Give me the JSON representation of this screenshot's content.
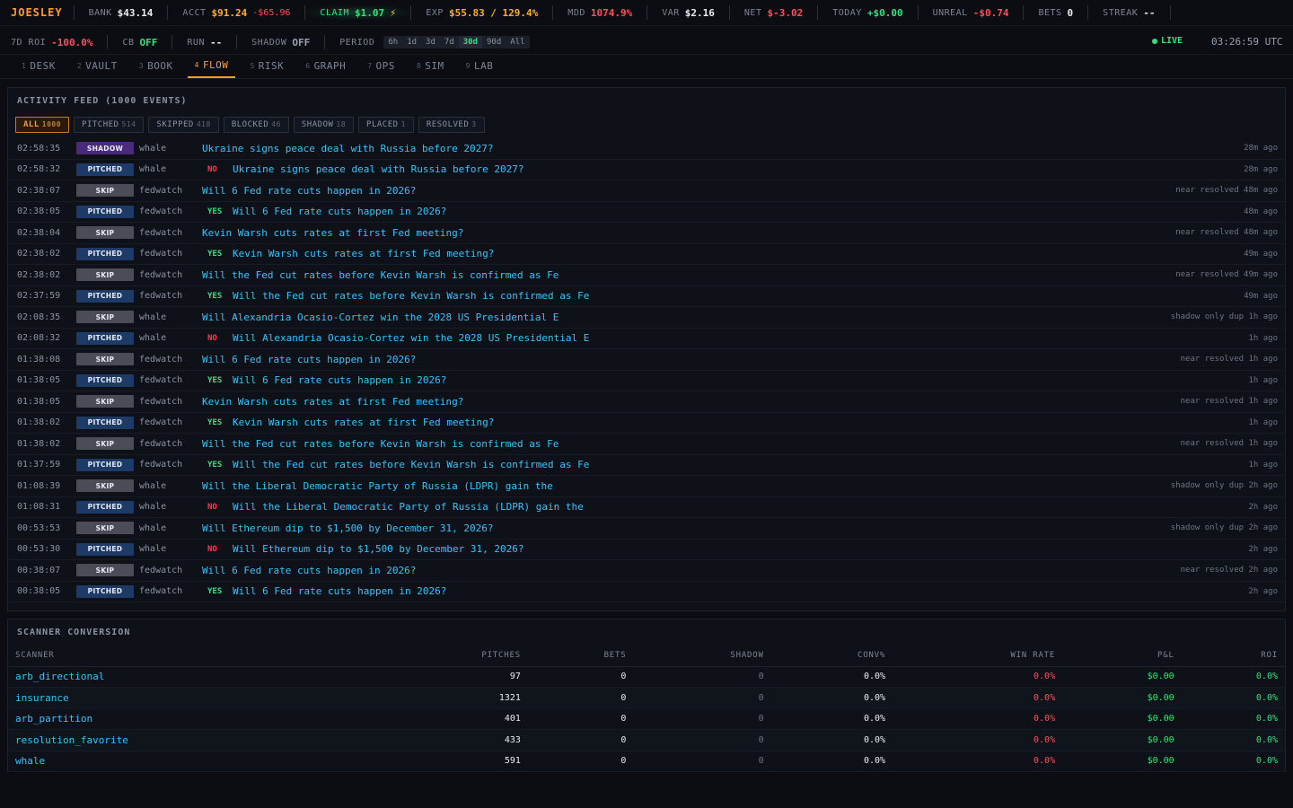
{
  "brand": "JOESLEY",
  "topstats": [
    {
      "k": "BANK",
      "v": "$43.14",
      "cls": ""
    },
    {
      "k": "ACCT",
      "v": "$91.24",
      "cls": "amber",
      "sub": "-$65.96"
    },
    {
      "k": "CLAIM",
      "v": "$1.07",
      "cls": "green",
      "claim": true
    },
    {
      "k": "EXP",
      "v": "$55.83 / 129.4%",
      "cls": "amber"
    },
    {
      "k": "MDD",
      "v": "1074.9%",
      "cls": "red"
    },
    {
      "k": "VAR",
      "v": "$2.16",
      "cls": ""
    },
    {
      "k": "NET",
      "v": "$-3.02",
      "cls": "red"
    },
    {
      "k": "TODAY",
      "v": "+$0.00",
      "cls": "green"
    },
    {
      "k": "UNREAL",
      "v": "-$0.74",
      "cls": "red"
    },
    {
      "k": "BETS",
      "v": "0",
      "cls": ""
    },
    {
      "k": "STREAK",
      "v": "--",
      "cls": ""
    }
  ],
  "row2": {
    "roi_label": "7D ROI",
    "roi_value": "-100.0%",
    "cb_label": "CB",
    "cb_value": "OFF",
    "run_label": "RUN",
    "run_value": "--",
    "shadow_label": "SHADOW",
    "shadow_value": "OFF",
    "period_label": "PERIOD",
    "periods": [
      "6h",
      "1d",
      "3d",
      "7d",
      "30d",
      "90d",
      "All"
    ],
    "active_period": "30d",
    "live": "LIVE",
    "clock": "03:26:59 UTC"
  },
  "tabs": [
    {
      "num": "1",
      "label": "DESK"
    },
    {
      "num": "2",
      "label": "VAULT"
    },
    {
      "num": "3",
      "label": "BOOK"
    },
    {
      "num": "4",
      "label": "FLOW",
      "active": true
    },
    {
      "num": "5",
      "label": "RISK"
    },
    {
      "num": "6",
      "label": "GRAPH"
    },
    {
      "num": "7",
      "label": "OPS"
    },
    {
      "num": "8",
      "label": "SIM"
    },
    {
      "num": "9",
      "label": "LAB"
    }
  ],
  "feed": {
    "title": "ACTIVITY FEED (1000 EVENTS)",
    "filters": [
      {
        "label": "ALL",
        "count": "1000",
        "active": true
      },
      {
        "label": "PITCHED",
        "count": "514"
      },
      {
        "label": "SKIPPED",
        "count": "418"
      },
      {
        "label": "BLOCKED",
        "count": "46"
      },
      {
        "label": "SHADOW",
        "count": "18"
      },
      {
        "label": "PLACED",
        "count": "1"
      },
      {
        "label": "RESOLVED",
        "count": "3"
      }
    ],
    "events": [
      {
        "time": "02:58:35",
        "badge": "SHADOW",
        "src": "whale",
        "side": "",
        "title": "Ukraine signs peace deal with Russia before 2027?",
        "right": "28m ago"
      },
      {
        "time": "02:58:32",
        "badge": "PITCHED",
        "src": "whale",
        "side": "NO",
        "title": "Ukraine signs peace deal with Russia before 2027?",
        "right": "28m ago"
      },
      {
        "time": "02:38:07",
        "badge": "SKIP",
        "src": "fedwatch",
        "side": "",
        "title": "Will 6 Fed rate cuts happen in 2026?",
        "right": "near resolved 48m ago"
      },
      {
        "time": "02:38:05",
        "badge": "PITCHED",
        "src": "fedwatch",
        "side": "YES",
        "title": "Will 6 Fed rate cuts happen in 2026?",
        "right": "48m ago"
      },
      {
        "time": "02:38:04",
        "badge": "SKIP",
        "src": "fedwatch",
        "side": "",
        "title": "Kevin Warsh cuts rates at first Fed meeting?",
        "right": "near resolved 48m ago"
      },
      {
        "time": "02:38:02",
        "badge": "PITCHED",
        "src": "fedwatch",
        "side": "YES",
        "title": "Kevin Warsh cuts rates at first Fed meeting?",
        "right": "49m ago"
      },
      {
        "time": "02:38:02",
        "badge": "SKIP",
        "src": "fedwatch",
        "side": "",
        "title": "Will the Fed cut rates before Kevin Warsh is confirmed as Fe",
        "right": "near resolved 49m ago"
      },
      {
        "time": "02:37:59",
        "badge": "PITCHED",
        "src": "fedwatch",
        "side": "YES",
        "title": "Will the Fed cut rates before Kevin Warsh is confirmed as Fe",
        "right": "49m ago"
      },
      {
        "time": "02:08:35",
        "badge": "SKIP",
        "src": "whale",
        "side": "",
        "title": "Will Alexandria Ocasio-Cortez win the 2028 US Presidential E",
        "right": "shadow only dup 1h ago"
      },
      {
        "time": "02:08:32",
        "badge": "PITCHED",
        "src": "whale",
        "side": "NO",
        "title": "Will Alexandria Ocasio-Cortez win the 2028 US Presidential E",
        "right": "1h ago"
      },
      {
        "time": "01:38:08",
        "badge": "SKIP",
        "src": "fedwatch",
        "side": "",
        "title": "Will 6 Fed rate cuts happen in 2026?",
        "right": "near resolved 1h ago"
      },
      {
        "time": "01:38:05",
        "badge": "PITCHED",
        "src": "fedwatch",
        "side": "YES",
        "title": "Will 6 Fed rate cuts happen in 2026?",
        "right": "1h ago"
      },
      {
        "time": "01:38:05",
        "badge": "SKIP",
        "src": "fedwatch",
        "side": "",
        "title": "Kevin Warsh cuts rates at first Fed meeting?",
        "right": "near resolved 1h ago"
      },
      {
        "time": "01:38:02",
        "badge": "PITCHED",
        "src": "fedwatch",
        "side": "YES",
        "title": "Kevin Warsh cuts rates at first Fed meeting?",
        "right": "1h ago"
      },
      {
        "time": "01:38:02",
        "badge": "SKIP",
        "src": "fedwatch",
        "side": "",
        "title": "Will the Fed cut rates before Kevin Warsh is confirmed as Fe",
        "right": "near resolved 1h ago"
      },
      {
        "time": "01:37:59",
        "badge": "PITCHED",
        "src": "fedwatch",
        "side": "YES",
        "title": "Will the Fed cut rates before Kevin Warsh is confirmed as Fe",
        "right": "1h ago"
      },
      {
        "time": "01:08:39",
        "badge": "SKIP",
        "src": "whale",
        "side": "",
        "title": "Will the Liberal Democratic Party of Russia (LDPR) gain the",
        "right": "shadow only dup 2h ago"
      },
      {
        "time": "01:08:31",
        "badge": "PITCHED",
        "src": "whale",
        "side": "NO",
        "title": "Will the Liberal Democratic Party of Russia (LDPR) gain the",
        "right": "2h ago"
      },
      {
        "time": "00:53:53",
        "badge": "SKIP",
        "src": "whale",
        "side": "",
        "title": "Will Ethereum dip to $1,500 by December 31, 2026?",
        "right": "shadow only dup 2h ago"
      },
      {
        "time": "00:53:30",
        "badge": "PITCHED",
        "src": "whale",
        "side": "NO",
        "title": "Will Ethereum dip to $1,500 by December 31, 2026?",
        "right": "2h ago"
      },
      {
        "time": "00:38:07",
        "badge": "SKIP",
        "src": "fedwatch",
        "side": "",
        "title": "Will 6 Fed rate cuts happen in 2026?",
        "right": "near resolved 2h ago"
      },
      {
        "time": "00:38:05",
        "badge": "PITCHED",
        "src": "fedwatch",
        "side": "YES",
        "title": "Will 6 Fed rate cuts happen in 2026?",
        "right": "2h ago"
      }
    ]
  },
  "scanner": {
    "title": "SCANNER CONVERSION",
    "columns": [
      "SCANNER",
      "PITCHES",
      "BETS",
      "SHADOW",
      "CONV%",
      "WIN RATE",
      "P&L",
      "ROI"
    ],
    "rows": [
      [
        "arb_directional",
        "97",
        "0",
        "0",
        "0.0%",
        "0.0%",
        "$0.00",
        "0.0%"
      ],
      [
        "insurance",
        "1321",
        "0",
        "0",
        "0.0%",
        "0.0%",
        "$0.00",
        "0.0%"
      ],
      [
        "arb_partition",
        "401",
        "0",
        "0",
        "0.0%",
        "0.0%",
        "$0.00",
        "0.0%"
      ],
      [
        "resolution_favorite",
        "433",
        "0",
        "0",
        "0.0%",
        "0.0%",
        "$0.00",
        "0.0%"
      ],
      [
        "whale",
        "591",
        "0",
        "0",
        "0.0%",
        "0.0%",
        "$0.00",
        "0.0%"
      ]
    ]
  },
  "colors": {
    "accent": "#ff9b2f",
    "green": "#2ee37f",
    "red": "#ff4d5e",
    "link": "#31c6ff"
  }
}
